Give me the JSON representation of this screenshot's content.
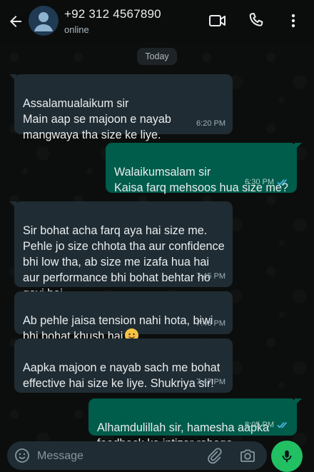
{
  "header": {
    "contact_name": "+92 312 4567890",
    "status": "online",
    "icons": [
      "back-arrow-icon",
      "avatar-placeholder-icon",
      "video-call-icon",
      "voice-call-icon",
      "more-options-icon"
    ]
  },
  "date_chip": "Today",
  "messages": [
    {
      "direction": "incoming",
      "text": "Assalamualaikum sir\nMain aap se majoon e nayab mangwaya tha size ke liye.",
      "time": "6:20 PM"
    },
    {
      "direction": "outgoing",
      "text": "Walaikumsalam sir\nKaisa farq mehsoos hua size me?",
      "time": "6:30 PM",
      "status": "read"
    },
    {
      "direction": "incoming",
      "text": "Sir bohat acha farq aya hai size me. Pehle jo size chhota tha aur confidence bhi low tha, ab size me izafa hua hai aur performance bhi bohat behtar ho gayi hai.",
      "time": "7:45 PM"
    },
    {
      "direction": "incoming",
      "text": "Ab pehle jaisa tension nahi hota, biwi bhi bohat khush hai",
      "emoji": "smiling-face-emoji",
      "time": "7:46 PM"
    },
    {
      "direction": "incoming",
      "text": "Aapka majoon e nayab sach me bohat effective hai size ke liye. Shukriya sir!",
      "time": "7:47 PM"
    },
    {
      "direction": "outgoing",
      "text": "Alhamdulillah sir, hamesha aapka feedback ka intizar rahega.",
      "time": "8:05 PM",
      "status": "read"
    }
  ],
  "composer": {
    "placeholder": "Message",
    "icons": [
      "emoji-icon",
      "attach-icon",
      "camera-icon",
      "mic-icon"
    ]
  },
  "colors": {
    "incoming_bubble": "#1f2c33",
    "outgoing_bubble": "#005c4b",
    "read_ticks": "#53bdeb",
    "mic_button": "#21c063"
  }
}
